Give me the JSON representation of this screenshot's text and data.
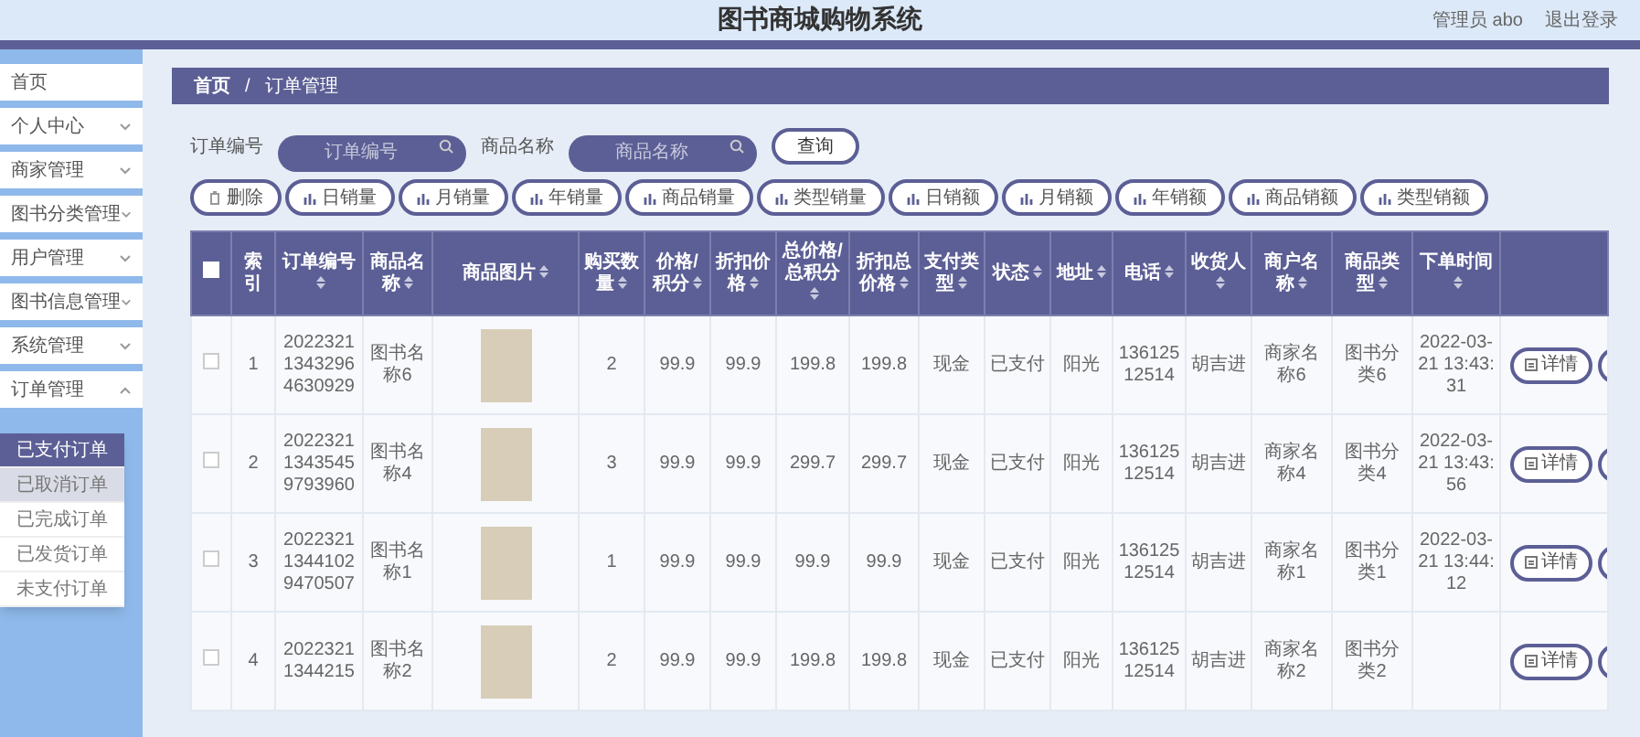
{
  "header": {
    "title": "图书商城购物系统",
    "user": "管理员 abo",
    "logout": "退出登录"
  },
  "sidebar": {
    "items": [
      {
        "label": "首页",
        "has_children": false
      },
      {
        "label": "个人中心",
        "has_children": true,
        "expanded": false
      },
      {
        "label": "商家管理",
        "has_children": true,
        "expanded": false
      },
      {
        "label": "图书分类管理",
        "has_children": true,
        "expanded": false
      },
      {
        "label": "用户管理",
        "has_children": true,
        "expanded": false
      },
      {
        "label": "图书信息管理",
        "has_children": true,
        "expanded": false
      },
      {
        "label": "系统管理",
        "has_children": true,
        "expanded": false
      },
      {
        "label": "订单管理",
        "has_children": true,
        "expanded": true,
        "children": [
          {
            "label": "已支付订单",
            "selected": true,
            "hovered": false
          },
          {
            "label": "已取消订单",
            "selected": false,
            "hovered": true
          },
          {
            "label": "已完成订单",
            "selected": false,
            "hovered": false
          },
          {
            "label": "已发货订单",
            "selected": false,
            "hovered": false
          },
          {
            "label": "未支付订单",
            "selected": false,
            "hovered": false
          }
        ]
      }
    ]
  },
  "breadcrumb": [
    "首页",
    "/",
    "订单管理"
  ],
  "search": {
    "fields": [
      {
        "label": "订单编号",
        "placeholder": "订单编号"
      },
      {
        "label": "商品名称",
        "placeholder": "商品名称"
      }
    ],
    "button": "查询"
  },
  "actions": [
    {
      "kind": "delete",
      "label": "删除"
    },
    {
      "kind": "chart",
      "label": "日销量"
    },
    {
      "kind": "chart",
      "label": "月销量"
    },
    {
      "kind": "chart",
      "label": "年销量"
    },
    {
      "kind": "chart",
      "label": "商品销量"
    },
    {
      "kind": "chart",
      "label": "类型销量"
    },
    {
      "kind": "chart",
      "label": "日销额"
    },
    {
      "kind": "chart",
      "label": "月销额"
    },
    {
      "kind": "chart",
      "label": "年销额"
    },
    {
      "kind": "chart",
      "label": "商品销额"
    },
    {
      "kind": "chart",
      "label": "类型销额"
    }
  ],
  "table": {
    "header_checkbox": {
      "checked": false
    },
    "columns": [
      {
        "label": "索引",
        "sortable": false
      },
      {
        "label": "订单编号",
        "sortable": true
      },
      {
        "label": "商品名称",
        "sortable": true
      },
      {
        "label": "商品图片",
        "sortable": true
      },
      {
        "label": "购买数量",
        "sortable": true
      },
      {
        "label": "价格/积分",
        "sortable": true
      },
      {
        "label": "折扣价格",
        "sortable": true
      },
      {
        "label": "总价格/总积分",
        "sortable": true
      },
      {
        "label": "折扣总价格",
        "sortable": true
      },
      {
        "label": "支付类型",
        "sortable": true
      },
      {
        "label": "状态",
        "sortable": true
      },
      {
        "label": "地址",
        "sortable": true
      },
      {
        "label": "电话",
        "sortable": true
      },
      {
        "label": "收货人",
        "sortable": true
      },
      {
        "label": "商户名称",
        "sortable": true
      },
      {
        "label": "商品类型",
        "sortable": true
      },
      {
        "label": "下单时间",
        "sortable": true
      }
    ],
    "rows": [
      {
        "checked": false,
        "cells": [
          "1",
          "202232113432964630929",
          "图书名称6",
          "",
          "2",
          "99.9",
          "99.9",
          "199.8",
          "199.8",
          "现金",
          "已支付",
          "阳光",
          "13612512514",
          "胡吉进",
          "商家名称6",
          "图书分类6",
          "2022-03-21 13:43:31"
        ],
        "detail": "详情"
      },
      {
        "checked": false,
        "cells": [
          "2",
          "202232113435459793960",
          "图书名称4",
          "",
          "3",
          "99.9",
          "99.9",
          "299.7",
          "299.7",
          "现金",
          "已支付",
          "阳光",
          "13612512514",
          "胡吉进",
          "商家名称4",
          "图书分类4",
          "2022-03-21 13:43:56"
        ],
        "detail": "详情"
      },
      {
        "checked": false,
        "cells": [
          "3",
          "202232113441029470507",
          "图书名称1",
          "",
          "1",
          "99.9",
          "99.9",
          "99.9",
          "99.9",
          "现金",
          "已支付",
          "阳光",
          "13612512514",
          "胡吉进",
          "商家名称1",
          "图书分类1",
          "2022-03-21 13:44:12"
        ],
        "detail": "详情"
      },
      {
        "checked": false,
        "cells": [
          "4",
          "20223211344215",
          "图书名称2",
          "",
          "2",
          "99.9",
          "99.9",
          "199.8",
          "199.8",
          "现金",
          "已支付",
          "阳光",
          "13612512514",
          "胡吉进",
          "商家名称2",
          "图书分类2",
          ""
        ],
        "detail": "详情"
      }
    ]
  }
}
